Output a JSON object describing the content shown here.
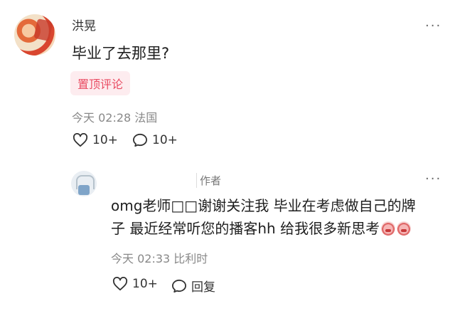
{
  "comment": {
    "username": "洪晃",
    "text": "毕业了去那里?",
    "pin_badge": "置顶评论",
    "time": "今天 02:28",
    "location": "法国",
    "likes": "10+",
    "comments": "10+"
  },
  "reply": {
    "username": "",
    "author_tag": "作者",
    "text_line1": "omg老师□□谢谢关注我 毕业在考虑做自己的牌",
    "text_line2": "子 最近经常听您的播客hh 给我很多新思考",
    "time": "今天 02:33",
    "location": "比利时",
    "likes": "10+",
    "reply_label": "回复"
  },
  "more_menu": "···",
  "icons": [
    "heart-outline",
    "comment-bubble",
    "ellipsis",
    "emoji-face"
  ]
}
